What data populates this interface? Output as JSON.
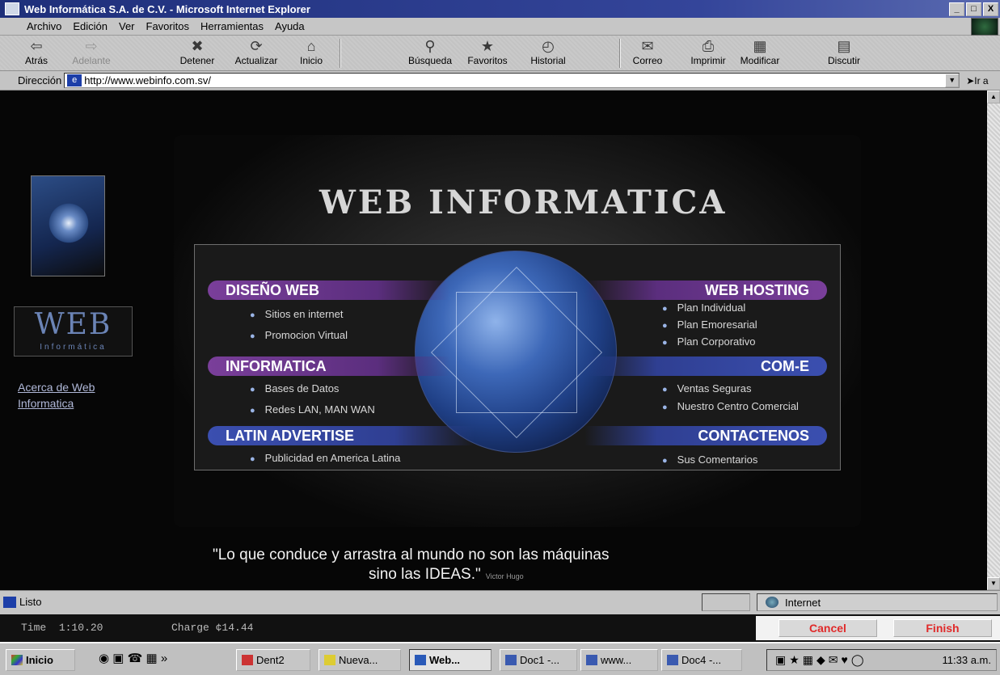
{
  "window": {
    "title": "Web Informática S.A. de C.V. - Microsoft Internet Explorer",
    "buttons": [
      "_",
      "๑",
      "X"
    ]
  },
  "menu": [
    "Archivo",
    "Edición",
    "Ver",
    "Favoritos",
    "Herramientas",
    "Ayuda"
  ],
  "toolbar": {
    "back": "Atrás",
    "forward": "Adelante",
    "stop": "Detener",
    "refresh": "Actualizar",
    "home": "Inicio",
    "search": "Búsqueda",
    "favorites": "Favoritos",
    "history": "Historial",
    "mail": "Correo",
    "print": "Imprimir",
    "edit": "Modificar",
    "discuss": "Discutir"
  },
  "address": {
    "label": "Dirección",
    "url": "http://www.webinfo.com.sv/",
    "go": "Ir a"
  },
  "page": {
    "logo_text": "WEB",
    "logo_sub": "Informática",
    "about_link": "Acerca de Web Informatica",
    "site_title": "WEB INFORMATICA",
    "sections": {
      "design": {
        "title": "DISEÑO WEB",
        "items": [
          "Sitios en internet",
          "Promocion Virtual"
        ]
      },
      "info": {
        "title": "INFORMATICA",
        "items": [
          "Bases de Datos",
          "Redes LAN, MAN WAN"
        ]
      },
      "advertise": {
        "title": "LATIN ADVERTISE",
        "items": [
          "Publicidad en America Latina"
        ]
      },
      "hosting": {
        "title": "WEB HOSTING",
        "items": [
          "Plan Individual",
          "Plan Emoresarial",
          "Plan Corporativo"
        ]
      },
      "come": {
        "title": "COM-E",
        "items": [
          "Ventas Seguras",
          "Nuestro Centro Comercial"
        ]
      },
      "contact": {
        "title": "CONTACTENOS",
        "items": [
          "Sus Comentarios"
        ]
      }
    },
    "quote_line1": "\"Lo que conduce y arrastra al mundo no son las máquinas",
    "quote_line2": "sino las IDEAS.\"",
    "quote_author": "Victor Hugo"
  },
  "status": {
    "text": "Listo",
    "zone": "Internet"
  },
  "dialup": {
    "time_label": "Time",
    "time_value": "1:10.20",
    "charge_label": "Charge",
    "charge_value": "¢14.44",
    "cancel": "Cancel",
    "finish": "Finish"
  },
  "taskbar": {
    "start": "Inicio",
    "tasks": [
      "Dent2",
      "Nueva...",
      "Web...",
      "Doc1 -...",
      "www...",
      "Doc4 -..."
    ],
    "clock": "11:33 a.m."
  },
  "colors": {
    "band_purple": "#7a3f9a",
    "band_blue": "#3b4fb0",
    "dialup_button_text": "#e02a2a"
  }
}
